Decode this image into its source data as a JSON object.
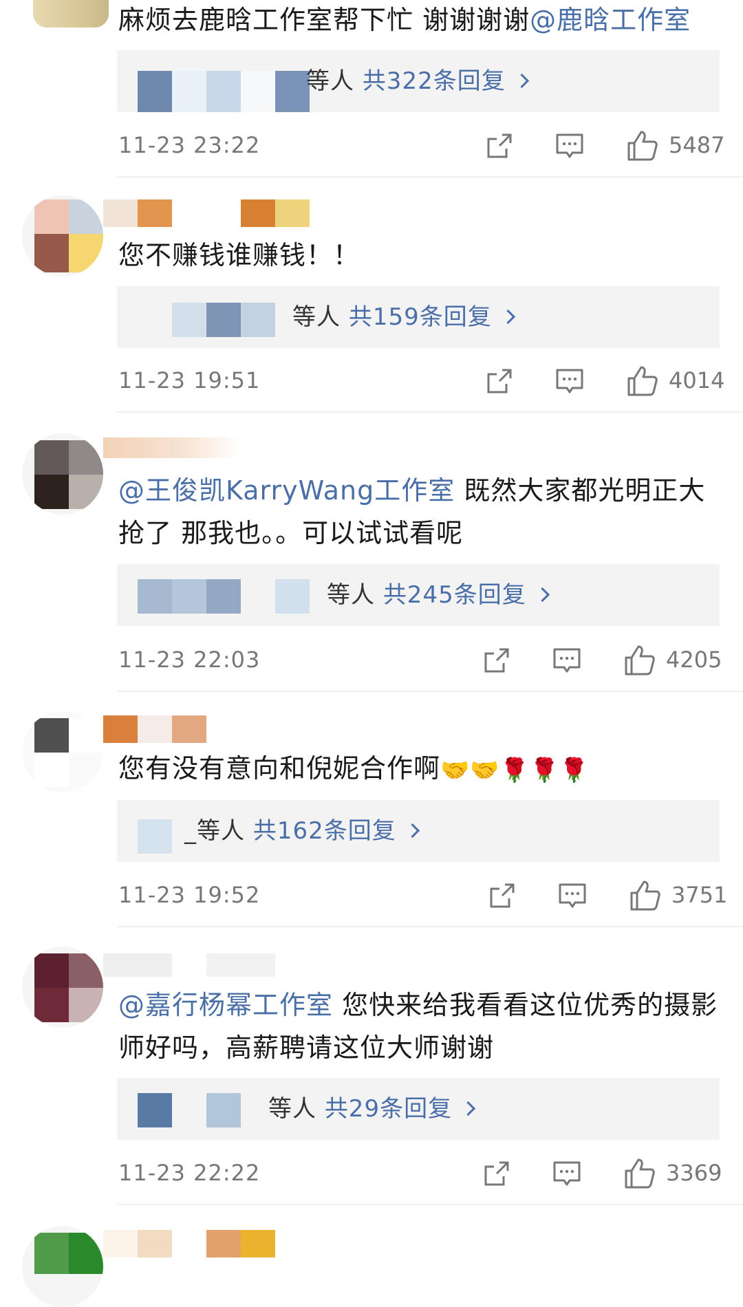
{
  "comments": [
    {
      "text_plain": "麻烦去鹿晗工作室帮下忙 谢谢谢谢",
      "mention_end": "@鹿晗工作室",
      "reply_who": "等人",
      "reply_count": "共322条回复",
      "time": "11-23 23:22",
      "likes": "5487"
    },
    {
      "text_plain": "您不赚钱谁赚钱！！",
      "reply_who": "等人",
      "reply_count": "共159条回复",
      "time": "11-23 19:51",
      "likes": "4014"
    },
    {
      "mention_start": "@王俊凯KarryWang工作室",
      "text_plain": " 既然大家都光明正大抢了 那我也。。可以试试看呢",
      "reply_who": "等人",
      "reply_count": "共245条回复",
      "time": "11-23 22:03",
      "likes": "4205"
    },
    {
      "text_plain": "您有没有意向和倪妮合作啊",
      "emojis": "🤝🤝🌹🌹🌹",
      "reply_who": "_等人",
      "reply_count": "共162条回复",
      "time": "11-23 19:52",
      "likes": "3751"
    },
    {
      "mention_start": "@嘉行杨幂工作室",
      "text_plain": " 您快来给我看看这位优秀的摄影师好吗，高薪聘请这位大师谢谢",
      "reply_who": "等人",
      "reply_count": "共29条回复",
      "time": "11-23 22:22",
      "likes": "3369"
    }
  ],
  "icons": {
    "share": "share-icon",
    "comment": "comment-icon",
    "like": "thumbs-up-icon"
  },
  "colors": {
    "mention": "#4a6fa8",
    "reply_box": "#f3f3f3",
    "meta_gray": "#777777",
    "text": "#1a1a1a"
  }
}
